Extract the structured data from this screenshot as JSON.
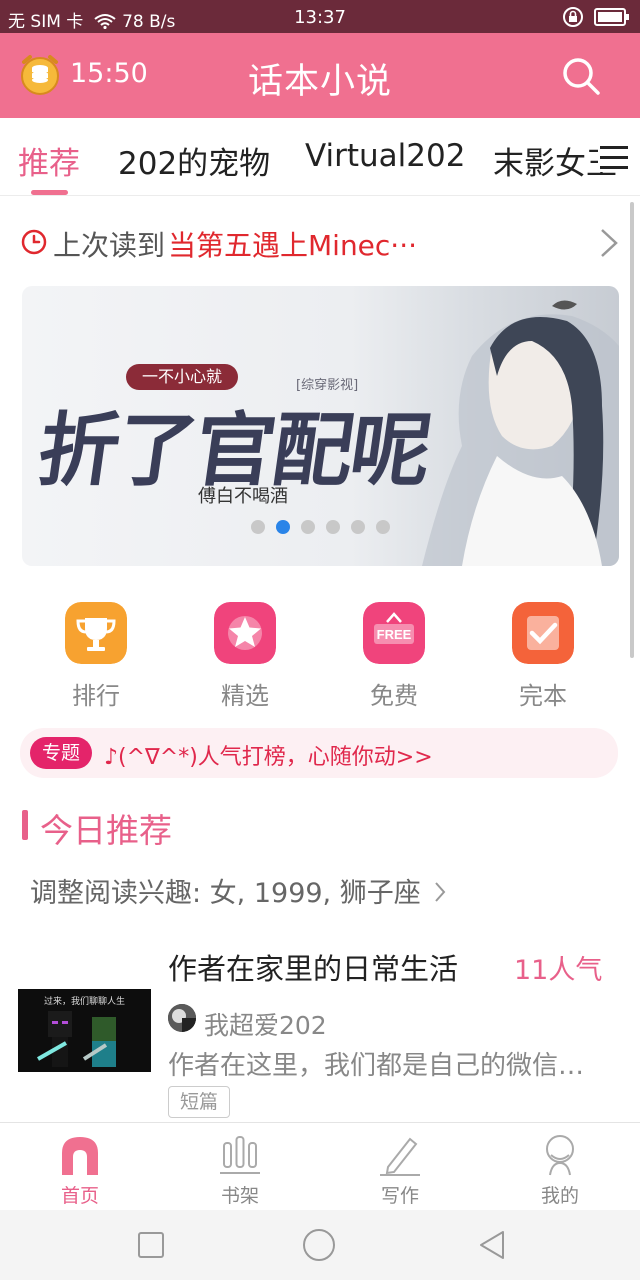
{
  "status_bar": {
    "carrier": "无 SIM 卡",
    "speed": "78 B/s",
    "time": "13:37"
  },
  "header": {
    "time": "15:50",
    "title": "话本小说"
  },
  "tabs": [
    {
      "label": "推荐"
    },
    {
      "label": "202的宠物"
    },
    {
      "label": "Virtual202"
    },
    {
      "label": "末影女王"
    }
  ],
  "last_read": {
    "prefix": "上次读到",
    "book": "当第五遇上Minec···"
  },
  "banner": {
    "badge": "一不小心就",
    "subtitle": "[综穿影视]",
    "title": "折了官配呢",
    "author": "傅白不喝酒"
  },
  "shortcuts": [
    {
      "label": "排行",
      "icon": "trophy-icon"
    },
    {
      "label": "精选",
      "icon": "star-icon"
    },
    {
      "label": "免费",
      "icon": "free-sign-icon"
    },
    {
      "label": "完本",
      "icon": "checkmark-icon"
    }
  ],
  "topic": {
    "tag": "专题",
    "text": "♪(^∇^*)人气打榜，心随你动>>"
  },
  "section": {
    "title": "今日推荐",
    "interest": "调整阅读兴趣: 女, 1999, 狮子座"
  },
  "book": {
    "cover_caption": "过来，我们聊聊人生",
    "title": "作者在家里的日常生活",
    "popularity": "11人气",
    "author": "我超爱202",
    "description": "作者在这里，我们都是自己的微信…",
    "tag": "短篇"
  },
  "bottom_nav": [
    {
      "label": "首页"
    },
    {
      "label": "书架"
    },
    {
      "label": "写作"
    },
    {
      "label": "我的"
    }
  ],
  "colors": {
    "status_bar": "#6b2a3a",
    "header": "#f07090",
    "accent": "#e8608a",
    "highlight": "#e0282e",
    "banner_dot_active": "#2a84e8"
  }
}
